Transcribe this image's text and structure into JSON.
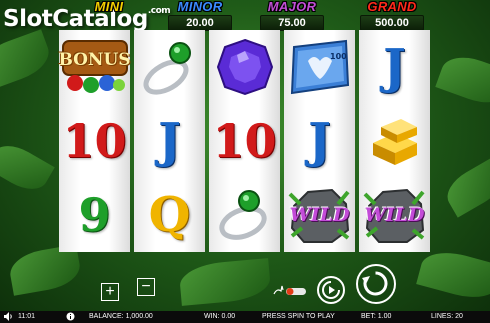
{
  "logo": {
    "text": "Slot",
    "text2": "Catalog",
    "domain": ".com"
  },
  "jackpots": [
    {
      "name": "MINI",
      "value": "",
      "color": "#f5d000"
    },
    {
      "name": "MINOR",
      "value": "20.00",
      "color": "#3a8bff"
    },
    {
      "name": "MAJOR",
      "value": "75.00",
      "color": "#c14fd6"
    },
    {
      "name": "GRAND",
      "value": "500.00",
      "color": "#ff2a1a"
    }
  ],
  "reels": [
    [
      "bonus",
      "10",
      "9"
    ],
    [
      "ring",
      "J",
      "Q"
    ],
    [
      "gem",
      "10",
      "ring"
    ],
    [
      "ticket",
      "J",
      "wild"
    ],
    [
      "J",
      "gold-bar",
      "wild"
    ]
  ],
  "symbols": {
    "bonus_label": "BONUS",
    "wild_label": "WILD",
    "ticket_value": "100"
  },
  "controls": {
    "increase": "+",
    "decrease": "−"
  },
  "status": {
    "time": "11:01",
    "balance": "BALANCE: 1,000.00",
    "win": "WIN: 0.00",
    "message": "PRESS SPIN TO PLAY",
    "bet": "BET: 1.00",
    "lines": "LINES: 20"
  }
}
